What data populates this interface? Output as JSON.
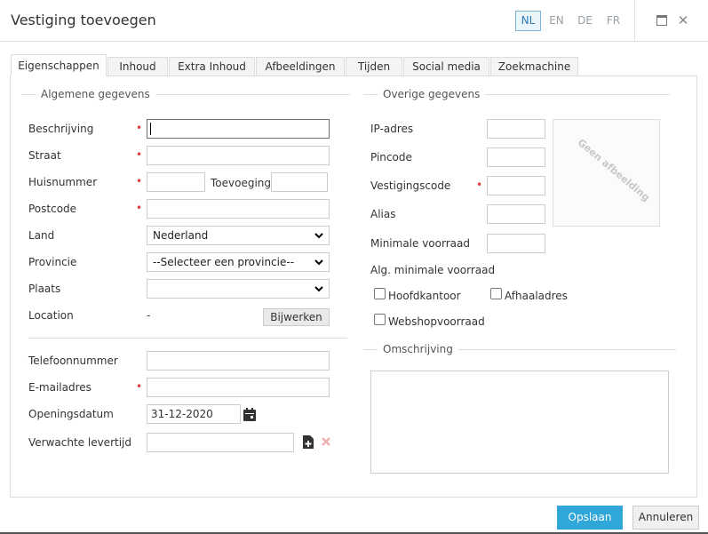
{
  "dialog": {
    "title": "Vestiging toevoegen"
  },
  "languages": [
    {
      "code": "NL",
      "active": true
    },
    {
      "code": "EN",
      "active": false
    },
    {
      "code": "DE",
      "active": false
    },
    {
      "code": "FR",
      "active": false
    }
  ],
  "window_buttons": {
    "maximize_icon": "maximize-icon",
    "close_icon": "close-icon",
    "close_glyph": "✕"
  },
  "tabs": [
    {
      "label": "Eigenschappen",
      "active": true
    },
    {
      "label": "Inhoud"
    },
    {
      "label": "Extra Inhoud"
    },
    {
      "label": "Afbeeldingen"
    },
    {
      "label": "Tijden"
    },
    {
      "label": "Social media"
    },
    {
      "label": "Zoekmachine"
    }
  ],
  "general": {
    "section_title": "Algemene gegevens",
    "required_mark": "•",
    "description": {
      "label": "Beschrijving",
      "value": ""
    },
    "street": {
      "label": "Straat",
      "value": ""
    },
    "house_number": {
      "label": "Huisnummer",
      "value": ""
    },
    "addition": {
      "label": "Toevoeging",
      "value": ""
    },
    "postcode": {
      "label": "Postcode",
      "value": ""
    },
    "country": {
      "label": "Land",
      "value": "Nederland"
    },
    "province": {
      "label": "Provincie",
      "value": "--Selecteer een provincie--"
    },
    "city": {
      "label": "Plaats",
      "value": ""
    },
    "location": {
      "label": "Location",
      "value": "-",
      "button": "Bijwerken"
    },
    "phone": {
      "label": "Telefoonnummer",
      "value": ""
    },
    "email": {
      "label": "E-mailadres",
      "value": ""
    },
    "opening_date": {
      "label": "Openingsdatum",
      "value": "31-12-2020",
      "icon": "calendar-icon"
    },
    "delivery_time": {
      "label": "Verwachte levertijd",
      "value": "",
      "add_icon": "add-file-icon",
      "remove_icon": "remove-icon"
    }
  },
  "other": {
    "section_title": "Overige gegevens",
    "ip": {
      "label": "IP-adres",
      "value": ""
    },
    "pincode": {
      "label": "Pincode",
      "value": ""
    },
    "branch_code": {
      "label": "Vestigingscode",
      "value": ""
    },
    "alias": {
      "label": "Alias",
      "value": ""
    },
    "min_stock": {
      "label": "Minimale voorraad",
      "value": ""
    },
    "general_min_stock": {
      "label": "Alg. minimale voorraad"
    },
    "checkboxes": {
      "head_office": {
        "label": "Hoofdkantoor",
        "checked": false
      },
      "pickup_address": {
        "label": "Afhaaladres",
        "checked": false
      },
      "webshop_stock": {
        "label": "Webshopvoorraad",
        "checked": false
      }
    },
    "image_placeholder": "Geen afbeelding"
  },
  "description_section": {
    "title": "Omschrijving",
    "value": ""
  },
  "footer": {
    "save": "Opslaan",
    "cancel": "Annuleren"
  },
  "colors": {
    "primary": "#2fa7d8",
    "required": "#e23a3a",
    "active_lang": "#2f79b5"
  }
}
